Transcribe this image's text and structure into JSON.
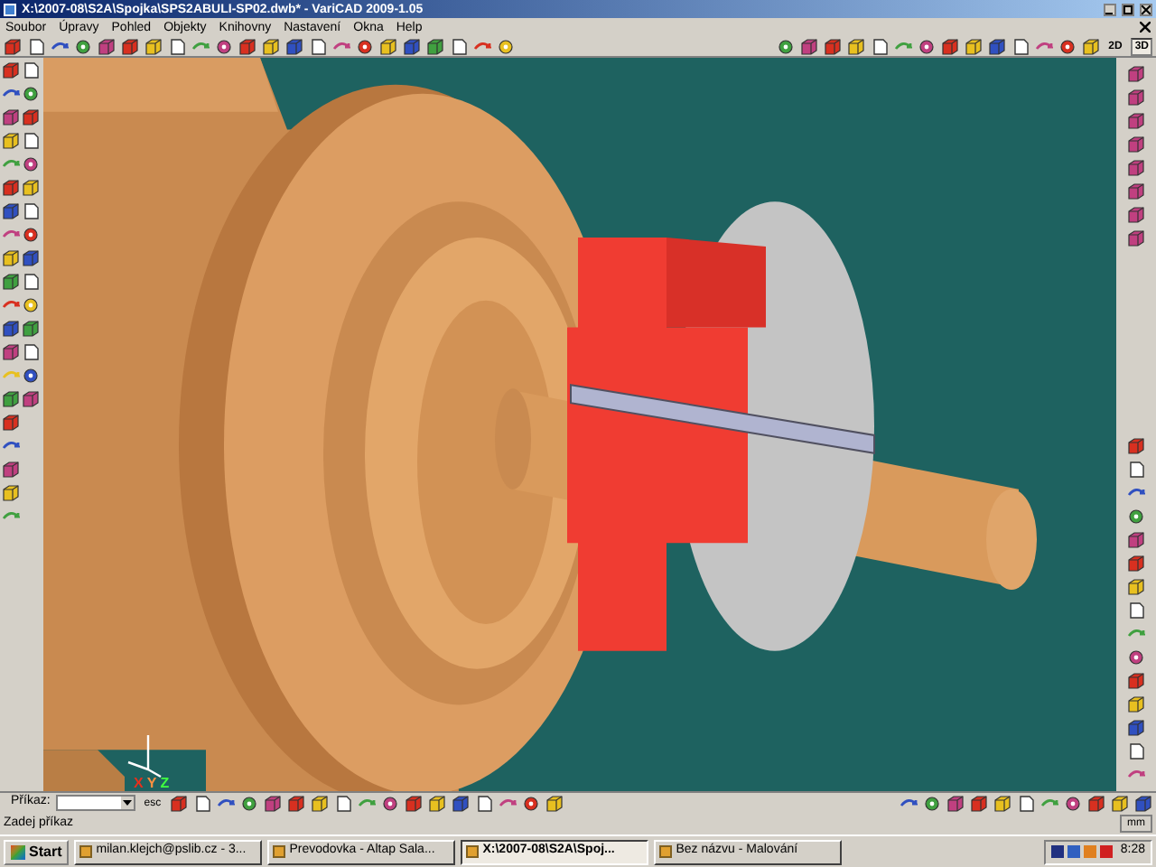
{
  "window": {
    "title": "X:\\2007-08\\S2A\\Spojka\\SPS2ABULI-SP02.dwb* - VariCAD 2009-1.05"
  },
  "menu": [
    "Soubor",
    "Úpravy",
    "Pohled",
    "Objekty",
    "Knihovny",
    "Nastavení",
    "Okna",
    "Help"
  ],
  "view_buttons": [
    {
      "label": "2D",
      "selected": false
    },
    {
      "label": "3D",
      "selected": true
    }
  ],
  "viewport": {
    "axis_labels": [
      {
        "text": "X",
        "color": "#e8301c"
      },
      {
        "text": "Y",
        "color": "#ff9040"
      },
      {
        "text": "Z",
        "color": "#40ff40"
      }
    ]
  },
  "command_bar": {
    "label": "Příkaz:",
    "button": "esc"
  },
  "status_bar": {
    "prompt": "Zadej příkaz",
    "units": "mm"
  },
  "taskbar": {
    "start": "Start",
    "tasks": [
      {
        "label": "milan.klejch@pslib.cz - 3...",
        "selected": false
      },
      {
        "label": "Prevodovka - Altap Sala...",
        "selected": false
      },
      {
        "label": "X:\\2007-08\\S2A\\Spoj...",
        "selected": true
      },
      {
        "label": "Bez názvu - Malování",
        "selected": false
      }
    ],
    "clock": "8:28"
  }
}
